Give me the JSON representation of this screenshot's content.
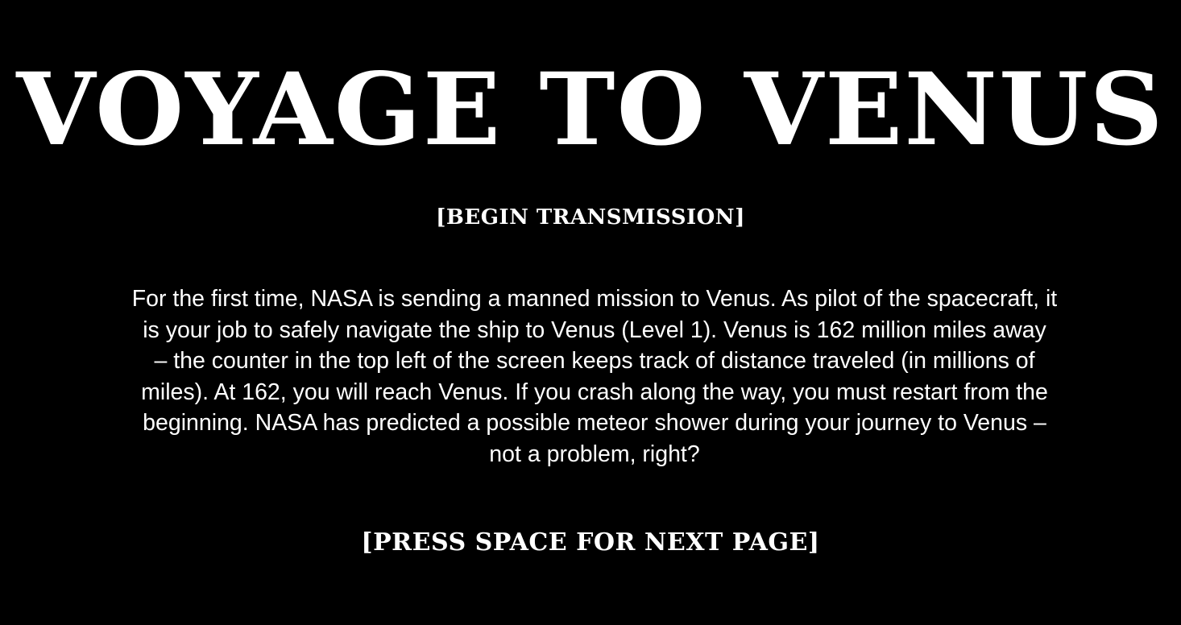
{
  "title": "VOYAGE TO VENUS",
  "transmission_start": "[BEGIN TRANSMISSION]",
  "story_text": "For the first time, NASA is sending a manned mission to Venus. As pilot of the spacecraft, it\nis your job to safely navigate the ship to Venus (Level 1).  Venus is 162 million miles away\n– the counter in the top left of the screen keeps track of distance traveled (in millions of\nmiles).  At 162, you will reach Venus.  If you crash along the way, you must restart from the\nbeginning.  NASA has predicted a possible meteor shower during your journey to Venus –\nnot a problem, right?",
  "next_prompt": "[PRESS SPACE FOR NEXT PAGE]",
  "colors": {
    "background": "#000000",
    "text": "#ffffff"
  }
}
